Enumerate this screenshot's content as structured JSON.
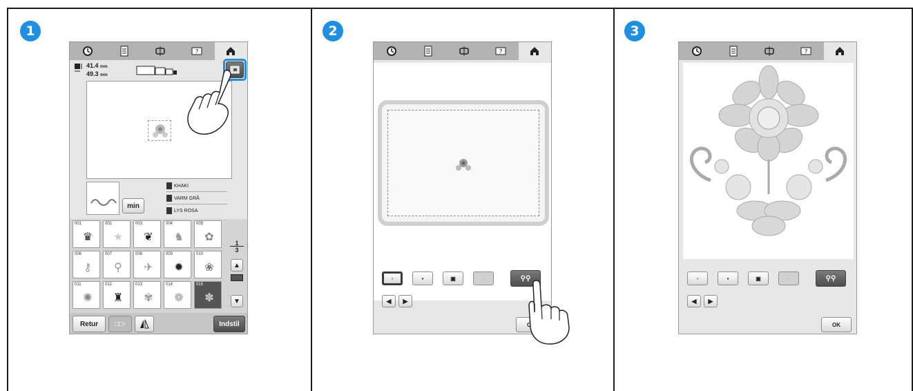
{
  "steps": [
    {
      "number": "1"
    },
    {
      "number": "2"
    },
    {
      "number": "3"
    }
  ],
  "screen1": {
    "dims": {
      "width": "41.4",
      "height": "49.3",
      "unit": "mm"
    },
    "threads": [
      "KHAKI",
      "VARM GRÅ",
      "LYS ROSA"
    ],
    "min_label": "min",
    "pattern_numbers": [
      "001",
      "002",
      "003",
      "004",
      "005",
      "006",
      "007",
      "008",
      "009",
      "010",
      "011",
      "012",
      "013",
      "014",
      "015"
    ],
    "page_indicator": {
      "current": "1",
      "total": "3"
    },
    "retur_label": "Retur",
    "indstil_label": "Indstil"
  },
  "screen2": {
    "ok_label": "OK"
  },
  "screen3": {
    "ok_label": "OK"
  },
  "colors": {
    "badge": "#1e8fe1",
    "highlight": "#1e8fe1",
    "topbar": "#b3b3b3",
    "screen_bg": "#e6e6e6"
  },
  "icons": [
    "clock-icon",
    "document-icon",
    "hoop-icon",
    "help-icon",
    "home-icon",
    "hand-pointer-icon",
    "flower-design-icon"
  ]
}
